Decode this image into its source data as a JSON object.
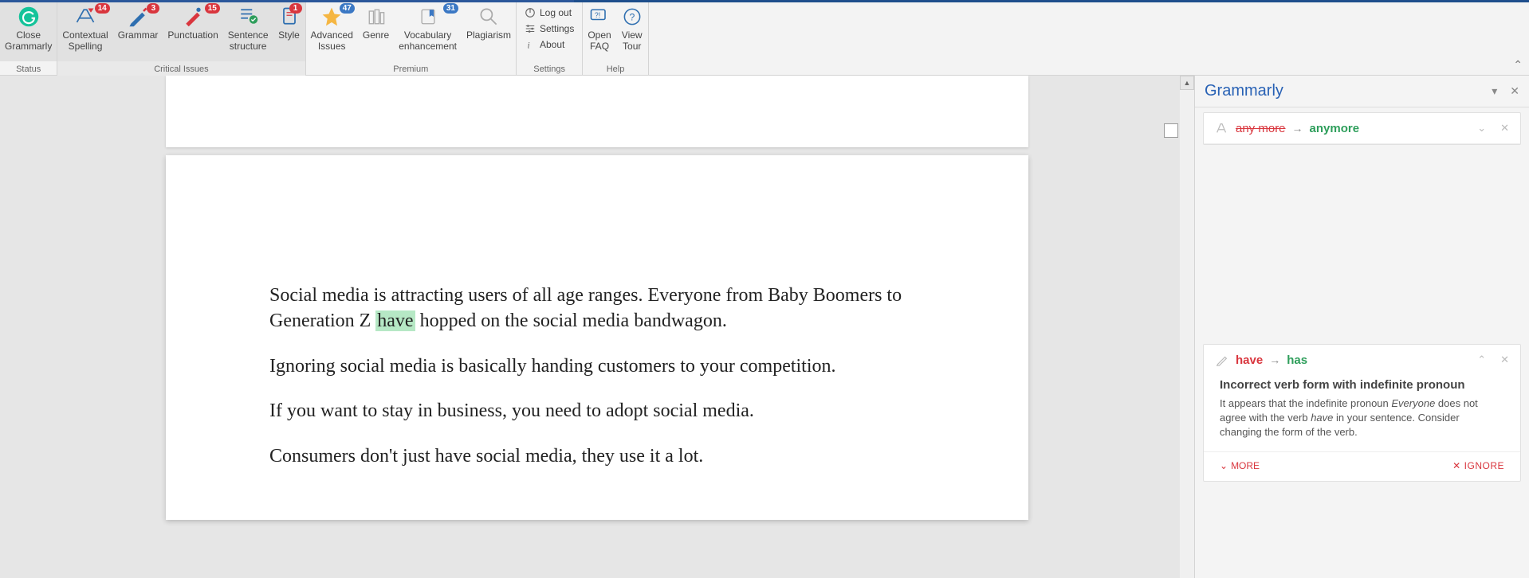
{
  "ribbon": {
    "status": {
      "close_label": "Close\nGrammarly",
      "group_label": "Status"
    },
    "critical": {
      "contextual_label": "Contextual\nSpelling",
      "contextual_badge": "14",
      "grammar_label": "Grammar",
      "grammar_badge": "3",
      "punctuation_label": "Punctuation",
      "punctuation_badge": "15",
      "sentence_label": "Sentence\nstructure",
      "style_label": "Style",
      "style_badge": "1",
      "group_label": "Critical Issues"
    },
    "premium": {
      "advanced_label": "Advanced\nIssues",
      "advanced_badge": "47",
      "genre_label": "Genre",
      "vocab_label": "Vocabulary\nenhancement",
      "vocab_badge": "31",
      "plag_label": "Plagiarism",
      "group_label": "Premium"
    },
    "settings": {
      "logout": "Log out",
      "settings": "Settings",
      "about": "About",
      "group_label": "Settings"
    },
    "help": {
      "faq_label": "Open\nFAQ",
      "tour_label": "View\nTour",
      "group_label": "Help"
    }
  },
  "document": {
    "p1a": "Social media is attracting users of all age ranges. Everyone from Baby Boomers to Generation Z ",
    "p1_hl": "have",
    "p1b": " hopped on the social media bandwagon.",
    "p2": "Ignoring social media is basically handing customers to your competition.",
    "p3": "If you want to stay in business,  you need to adopt social media.",
    "p4": "Consumers don't just have social media, they use it a lot."
  },
  "panel": {
    "title": "Grammarly",
    "card1": {
      "orig": "any more",
      "corr": "anymore"
    },
    "card2": {
      "orig": "have",
      "corr": "has",
      "title": "Incorrect verb form with indefinite pronoun",
      "desc_a": "It appears that the indefinite pronoun ",
      "desc_em1": "Everyone",
      "desc_b": " does not agree with the verb ",
      "desc_em2": "have",
      "desc_c": " in your sentence. Consider changing the form of the verb.",
      "more": "MORE",
      "ignore": "IGNORE"
    }
  }
}
